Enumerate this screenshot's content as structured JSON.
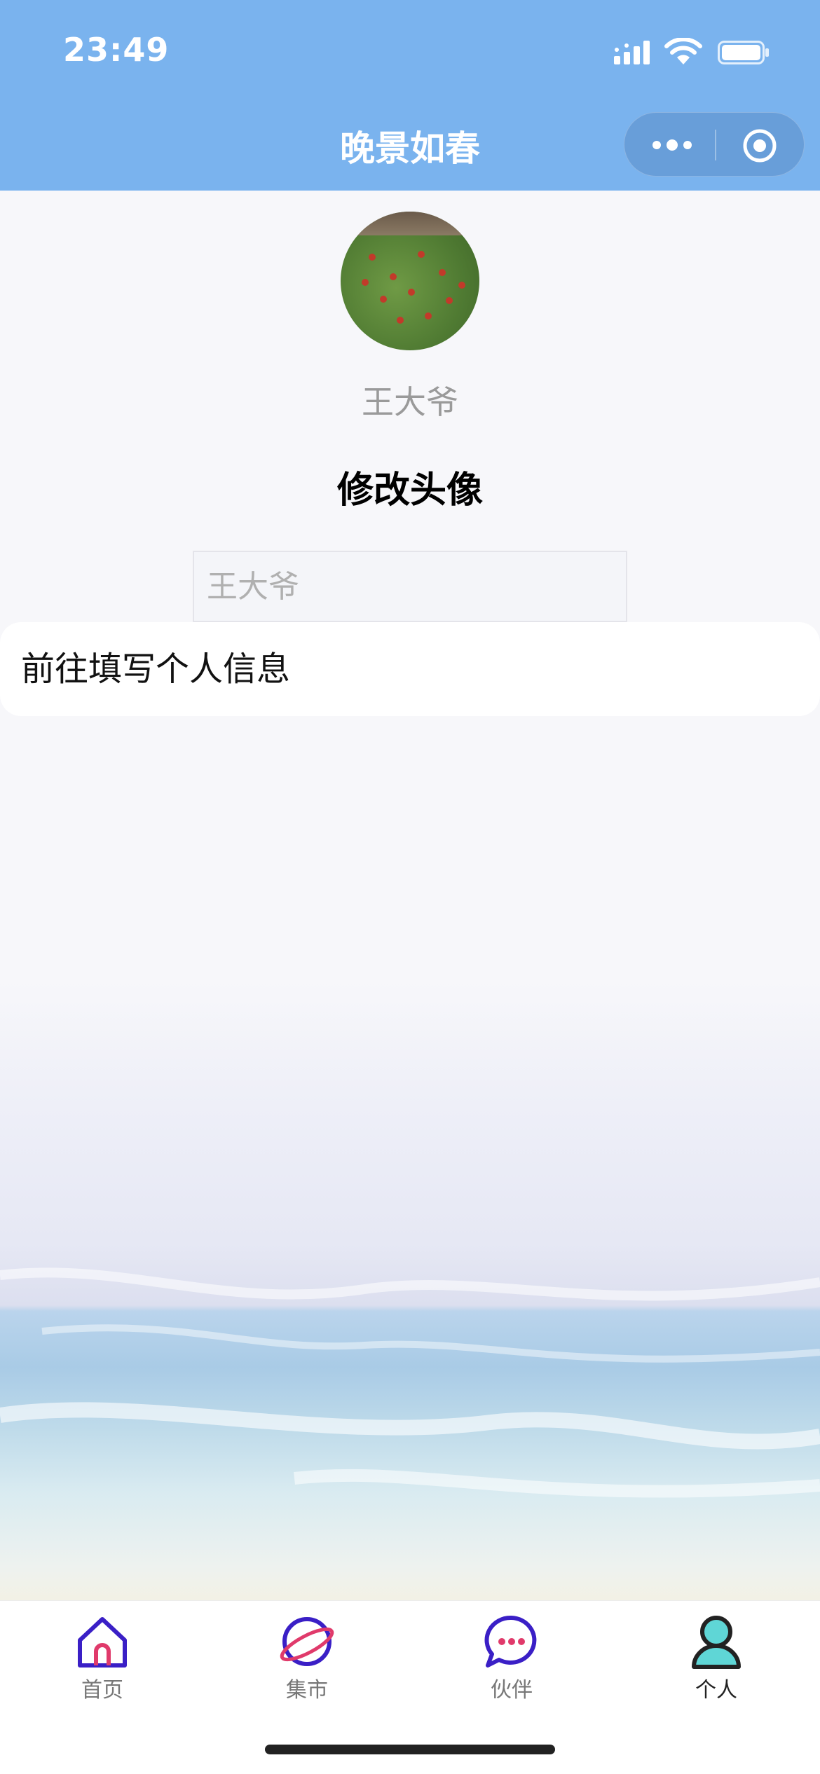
{
  "status_bar": {
    "time": "23:49",
    "icons": [
      "signal-icon",
      "wifi-icon",
      "battery-icon"
    ]
  },
  "nav": {
    "title": "晚景如春",
    "capsule_icons": [
      "more-icon",
      "target-icon"
    ]
  },
  "profile": {
    "name": "王大爷",
    "edit_avatar_label": "修改头像",
    "nickname_placeholder": "王大爷",
    "info_link_label": "前往填写个人信息"
  },
  "tabbar": {
    "items": [
      {
        "label": "首页",
        "icon": "home-icon"
      },
      {
        "label": "集市",
        "icon": "planet-icon"
      },
      {
        "label": "伙伴",
        "icon": "chat-bubble-icon"
      },
      {
        "label": "个人",
        "icon": "person-icon"
      }
    ],
    "active_index": 3
  },
  "colors": {
    "header": "#7ab3ee",
    "icon_purple": "#3a1fc6",
    "icon_pink": "#e03a6b",
    "icon_teal": "#5fd6d6"
  }
}
